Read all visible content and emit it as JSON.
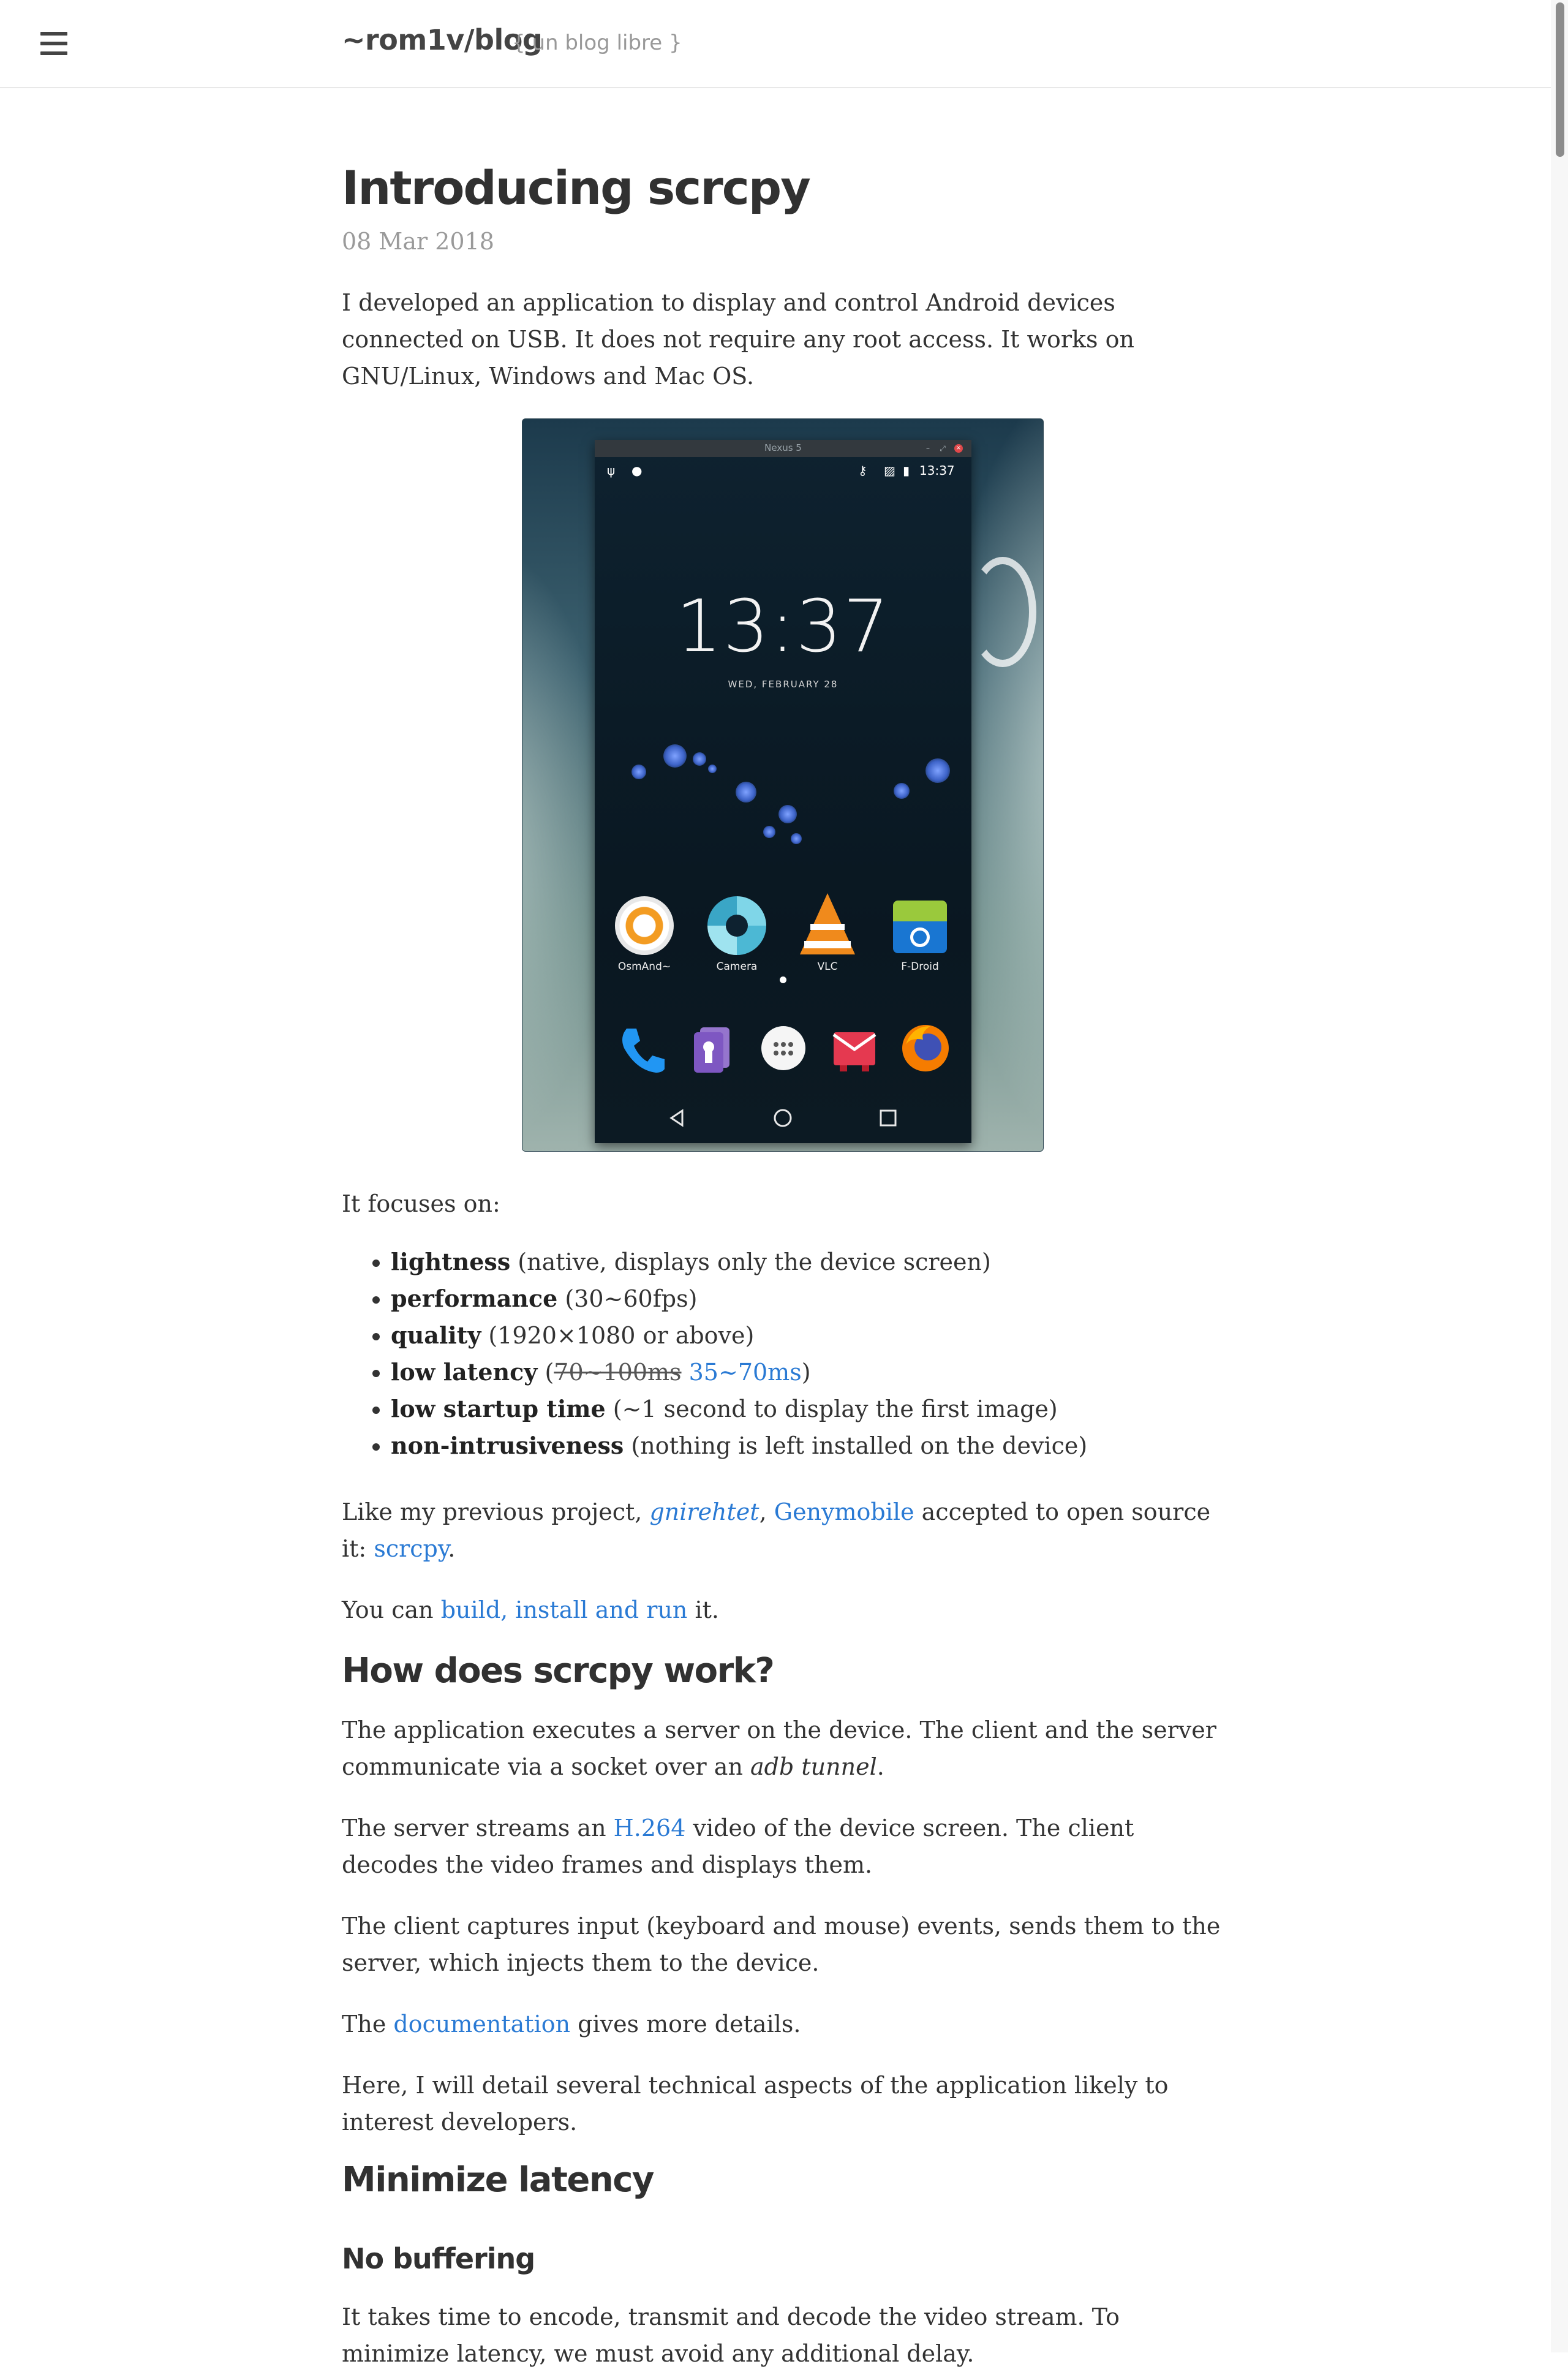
{
  "header": {
    "menu_icon": "hamburger-menu-icon",
    "site_title": "~rom1v/blog",
    "tagline": "{ un blog libre }"
  },
  "post": {
    "title": "Introducing scrcpy",
    "date": "08 Mar 2018",
    "intro": "I developed an application to display and control Android devices connected on USB. It does not require any root access. It works on GNU/Linux, Windows and Mac OS.",
    "screenshot": {
      "window_title": "Nexus 5",
      "status_time": "13:37",
      "clock": "13:37",
      "clock_date": "WED, FEBRUARY 28",
      "apps": [
        {
          "label": "OsmAnd~",
          "icon": "osmand-icon"
        },
        {
          "label": "Camera",
          "icon": "camera-icon"
        },
        {
          "label": "VLC",
          "icon": "vlc-icon"
        },
        {
          "label": "F-Droid",
          "icon": "fdroid-icon"
        }
      ],
      "dock": [
        "phone-icon",
        "contacts-icon",
        "app-drawer-icon",
        "email-icon",
        "firefox-icon"
      ],
      "nav": [
        "back-icon",
        "home-icon",
        "recents-icon"
      ]
    },
    "focus_intro": "It focuses on:",
    "focus_items": [
      {
        "term": "lightness",
        "desc": " (native, displays only the device screen)"
      },
      {
        "term": "performance",
        "desc": " (30~60fps)"
      },
      {
        "term": "quality",
        "desc": " (1920×1080 or above)"
      },
      {
        "term": "low latency",
        "desc_open": " (",
        "old_value": "70~100ms",
        "new_value": "35~70ms",
        "desc_close": ")"
      },
      {
        "term": "low startup time",
        "desc": " (~1 second to display the first image)"
      },
      {
        "term": "non-intrusiveness",
        "desc": " (nothing is left installed on the device)"
      }
    ],
    "previous_project": {
      "before": "Like my previous project, ",
      "link_gnirehtet": "gnirehtet",
      "sep": ", ",
      "link_genymobile": "Genymobile",
      "middle": " accepted to open source it: ",
      "link_scrcpy": "scrcpy",
      "after": "."
    },
    "build": {
      "before": "You can ",
      "link": "build, install and run",
      "after": " it."
    },
    "section_how": "How does scrcpy work?",
    "how_p1": {
      "before": "The application executes a server on the device. The client and the server communicate via a socket over an ",
      "em": "adb tunnel",
      "after": "."
    },
    "how_p2": {
      "before": "The server streams an ",
      "link": "H.264",
      "after": " video of the device screen. The client decodes the video frames and displays them."
    },
    "how_p3": "The client captures input (keyboard and mouse) events, sends them to the server, which injects them to the device.",
    "how_p4": {
      "before": "The ",
      "link": "documentation",
      "after": " gives more details."
    },
    "how_p5": "Here, I will detail several technical aspects of the application likely to interest developers.",
    "section_latency": "Minimize latency",
    "subsection_buffering": "No buffering",
    "buffering_p1": "It takes time to encode, transmit and decode the video stream. To minimize latency, we must avoid any additional delay."
  },
  "colors": {
    "link": "#2a7ad4",
    "text": "#333333",
    "muted": "#9a9a9a"
  }
}
